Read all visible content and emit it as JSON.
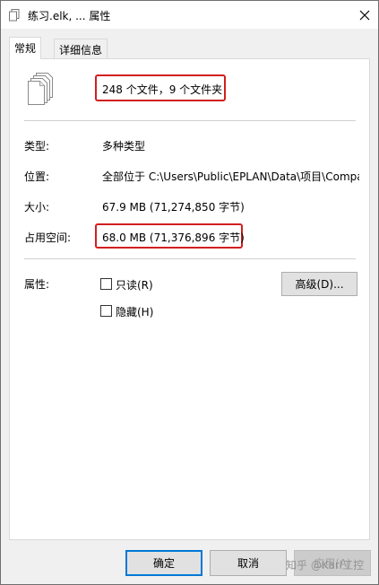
{
  "window": {
    "title": "练习.elk, ... 属性"
  },
  "tabs": [
    {
      "label": "常规",
      "active": true
    },
    {
      "label": "详细信息",
      "active": false
    }
  ],
  "summary": "248 个文件，9 个文件夹",
  "properties": {
    "type_label": "类型:",
    "type_value": "多种类型",
    "location_label": "位置:",
    "location_value": "全部位于 C:\\Users\\Public\\EPLAN\\Data\\项目\\Compa",
    "size_label": "大小:",
    "size_value": "67.9 MB (71,274,850 字节)",
    "disk_label": "占用空间:",
    "disk_value": "68.0 MB (71,376,896 字节)"
  },
  "attributes": {
    "label": "属性:",
    "readonly": {
      "label": "只读(R)",
      "checked": false
    },
    "hidden": {
      "label": "隐藏(H)",
      "checked": false
    },
    "advanced_button": "高级(D)..."
  },
  "buttons": {
    "ok": "确定",
    "cancel": "取消",
    "apply": "应用(A)"
  },
  "watermark": "知乎 @Karl工控",
  "colors": {
    "highlight": "#d21f1f",
    "focus": "#0078d7"
  }
}
